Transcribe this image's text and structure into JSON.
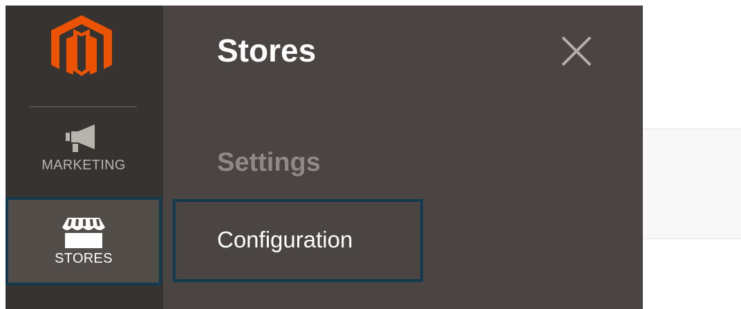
{
  "app": {
    "brand": "Magento",
    "brand_color": "#eb5202"
  },
  "menu": {
    "items": [
      {
        "key": "marketing",
        "label": "MARKETING",
        "icon": "megaphone-icon",
        "active": false
      },
      {
        "key": "stores",
        "label": "STORES",
        "icon": "storefront-icon",
        "active": true
      }
    ]
  },
  "submenu": {
    "title": "Stores",
    "close_icon": "close-icon",
    "sections": [
      {
        "title": "Settings",
        "links": [
          {
            "label": "Configuration",
            "focused": true
          }
        ]
      }
    ]
  },
  "colors": {
    "rail_bg": "#373330",
    "panel_bg": "#4a4542",
    "active_item_bg": "#524d49",
    "focus_outline": "#123a4e",
    "section_title": "#8f8985"
  }
}
